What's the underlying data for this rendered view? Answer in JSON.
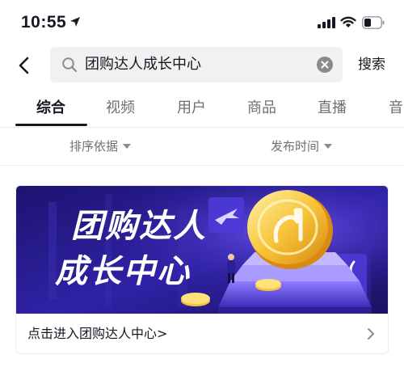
{
  "status_bar": {
    "time": "10:55",
    "icons": [
      "location-arrow-icon",
      "signal-icon",
      "wifi-icon",
      "battery-icon"
    ]
  },
  "search": {
    "query": "团购达人成长中心",
    "submit_label": "搜索",
    "icons": [
      "back-icon",
      "search-icon",
      "clear-icon"
    ]
  },
  "tabs": [
    {
      "label": "综合",
      "active": true
    },
    {
      "label": "视频",
      "active": false
    },
    {
      "label": "用户",
      "active": false
    },
    {
      "label": "商品",
      "active": false
    },
    {
      "label": "直播",
      "active": false
    },
    {
      "label": "音",
      "active": false
    }
  ],
  "filters": {
    "sort_label": "排序依据",
    "time_label": "发布时间"
  },
  "card": {
    "banner_line1": "团购达人",
    "banner_line2": "成长中心",
    "footer_text": "点击进入团购达人中心>"
  },
  "colors": {
    "banner_bg": "#2b1f8f",
    "banner_accent": "#5a3be0",
    "coin_gold": "#f7c53a",
    "text_primary": "#161823",
    "text_secondary": "#6e6f76"
  }
}
